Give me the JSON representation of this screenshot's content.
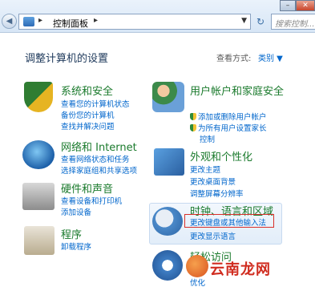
{
  "address_bar": {
    "path_segment": "控制面板",
    "search_placeholder": "搜索控制..."
  },
  "nav": {
    "back": "◀",
    "forward": "▶",
    "refresh": "↻"
  },
  "window": {
    "minimize": "–",
    "close": "✕"
  },
  "heading": "调整计算机的设置",
  "view_by": {
    "label": "查看方式:",
    "value": "类别 ▼"
  },
  "categories": [
    {
      "title": "系统和安全",
      "links": [
        "查看您的计算机状态",
        "备份您的计算机",
        "查找并解决问题"
      ]
    },
    {
      "title": "网络和 Internet",
      "links": [
        "查看网络状态和任务",
        "选择家庭组和共享选项"
      ]
    },
    {
      "title": "硬件和声音",
      "links": [
        "查看设备和打印机",
        "添加设备"
      ]
    },
    {
      "title": "程序",
      "links": [
        "卸载程序"
      ]
    },
    {
      "title": "用户帐户和家庭安全",
      "links": [
        "添加或删除用户帐户",
        "为所有用户设置家长",
        "控制"
      ]
    },
    {
      "title": "外观和个性化",
      "links": [
        "更改主题",
        "更改桌面背景",
        "调整屏幕分辨率"
      ]
    },
    {
      "title": "时钟、语言和区域",
      "links": [
        "更改键盘或其他输入法",
        "更改显示语言"
      ]
    },
    {
      "title": "轻松访问",
      "links": [
        "使用",
        "优化"
      ]
    }
  ],
  "watermark": "云南龙网",
  "colors": {
    "category_title": "#1a7a2c",
    "link": "#0066cc",
    "highlight": "#d9302a"
  }
}
